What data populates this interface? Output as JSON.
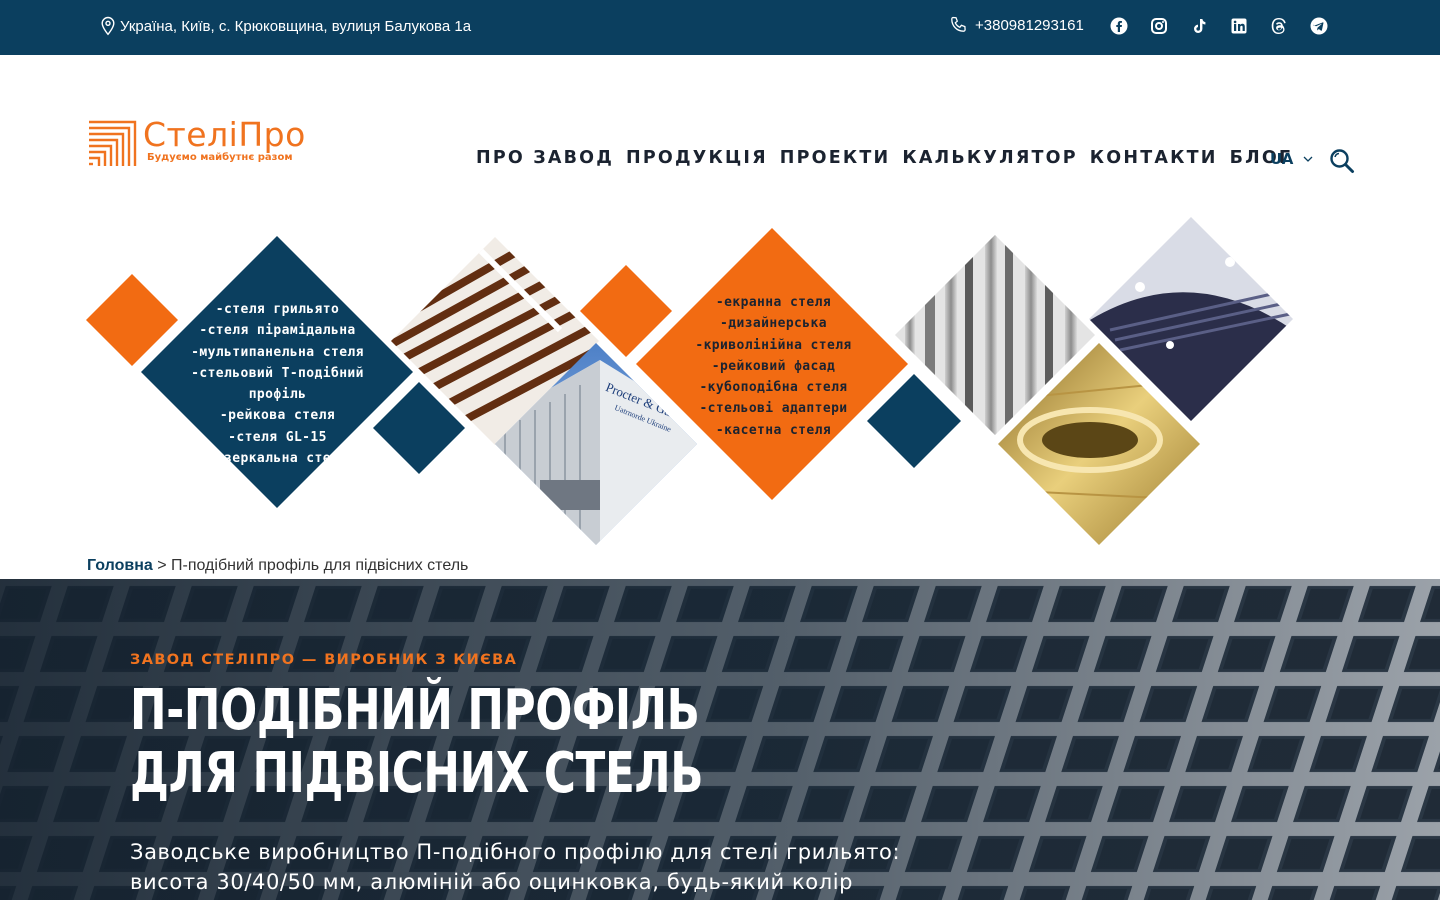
{
  "topbar": {
    "address": "Україна, Київ, с. Крюковщина, вулиця Балукова 1а",
    "phone": "+380981293161",
    "social": [
      "facebook-icon",
      "instagram-icon",
      "tiktok-icon",
      "linkedin-icon",
      "threads-icon",
      "telegram-icon"
    ]
  },
  "logo": {
    "name": "СтеліПро",
    "slogan": "Будуємо майбутнє разом"
  },
  "nav": [
    "ПРО ЗАВОД",
    "ПРОДУКЦІЯ",
    "ПРОЕКТИ",
    "КАЛЬКУЛЯТОР",
    "КОНТАКТИ",
    "БЛОГ"
  ],
  "lang": "UA",
  "products_left": [
    "-стеля грильято",
    "-стеля пірамідальна",
    "-мультипанельна стеля",
    "-стельовий Т-подібний профіль",
    "-рейкова стеля",
    "-стеля GL-15",
    "-дзеркальна стеля"
  ],
  "products_right": [
    "-екранна стеля",
    "-дизайнерська",
    "-криволінійна стеля",
    "-рейковий фасад",
    "-кубоподібна стеля",
    "-стельові адаптери",
    "-касетна стеля"
  ],
  "photo_texts": {
    "building_sign": "Procter & Gamble",
    "building_sub": "Uatrnorde Ukraine"
  },
  "breadcrumb": {
    "home": "Головна",
    "separator": " > ",
    "current": "П-подібний профіль для підвісних стель"
  },
  "hero": {
    "eyebrow": "ЗАВОД СТЕЛІПРО — ВИРОБНИК З КИЄВА",
    "title_line1": "П-ПОДІБНИЙ ПРОФІЛЬ",
    "title_line2": "ДЛЯ ПІДВІСНИХ СТЕЛЬ",
    "desc_line1": "Заводське виробництво П-подібного профілю для стелі грильято:",
    "desc_line2": "висота 30/40/50 мм, алюміній або оцинковка, будь-який колір"
  },
  "colors": {
    "navy": "#0b3f5f",
    "orange": "#f26b12",
    "accent": "#f0731f"
  }
}
